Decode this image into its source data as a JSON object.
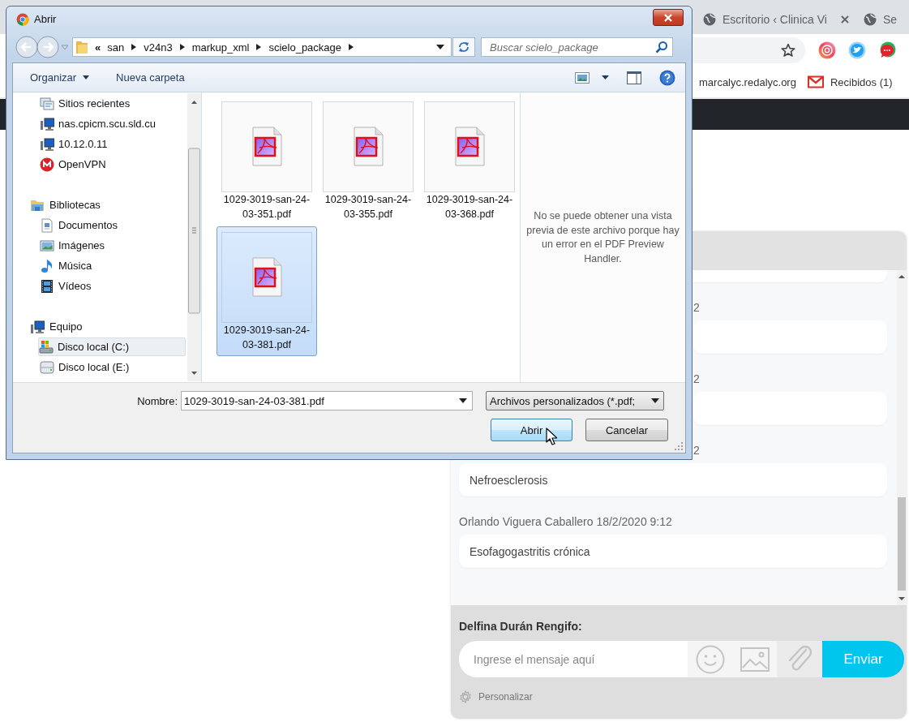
{
  "browser": {
    "tabs": [
      {
        "title": "Escritorio ‹ Clinica Vi",
        "selected": false,
        "closable": true
      },
      {
        "title": "Se",
        "selected": false,
        "closable": false
      }
    ],
    "bookmarks": [
      {
        "kind": "site",
        "label": "marcalyc.redalyc.org"
      },
      {
        "kind": "mail",
        "label": "Recibidos (1)"
      }
    ]
  },
  "chat": {
    "messages": [
      {
        "kind": "partial"
      },
      {
        "kind": "message",
        "header": "2",
        "header_covered": true,
        "bubble_covered": true
      },
      {
        "kind": "message",
        "header": "2",
        "header_covered": true,
        "bubble_covered": true
      },
      {
        "kind": "message",
        "header": "2",
        "header_covered": true,
        "bubble_covered": false,
        "text": "Nefroesclerosis"
      },
      {
        "kind": "message",
        "header": "Orlando Viguera Caballero 18/2/2020 9:12",
        "header_covered": false,
        "bubble_covered": false,
        "text": "Esofagogastritis crónica"
      }
    ],
    "sender": "Delfina Durán Rengifo:",
    "input": {
      "placeholder": "Ingrese el mensaje aquí"
    },
    "send_button": "Enviar",
    "settings_link": "Personalizar"
  },
  "dialog": {
    "title": "Abrir",
    "path": {
      "overflow_mark": "«",
      "segments": [
        "san",
        "v24n3",
        "markup_xml",
        "scielo_package"
      ]
    },
    "search": {
      "placeholder": "Buscar scielo_package"
    },
    "toolbar": [
      {
        "label": "Organizar",
        "menu": true
      },
      {
        "label": "Nueva carpeta",
        "menu": false
      }
    ],
    "sidebar": {
      "tree": [
        {
          "children": [
            {
              "label": "Sitios recientes",
              "kind": "recent",
              "selected": false
            },
            {
              "label": "nas.cpicm.scu.sld.cu",
              "kind": "network",
              "selected": false
            },
            {
              "label": "10.12.0.11",
              "kind": "network",
              "selected": false
            },
            {
              "label": "OpenVPN",
              "kind": "vpn",
              "selected": false
            }
          ]
        },
        {
          "label": "Bibliotecas",
          "kind": "library",
          "selected": false,
          "children": [
            {
              "label": "Documentos",
              "kind": "documents",
              "selected": false
            },
            {
              "label": "Imágenes",
              "kind": "pictures",
              "selected": false
            },
            {
              "label": "Música",
              "kind": "music",
              "selected": false
            },
            {
              "label": "Vídeos",
              "kind": "videos",
              "selected": false
            }
          ]
        },
        {
          "label": "Equipo",
          "kind": "computer",
          "selected": false,
          "children": [
            {
              "label": "Disco local (C:)",
              "kind": "system_drive",
              "selected": true
            },
            {
              "label": "Disco local (E:)",
              "kind": "drive",
              "selected": false
            }
          ]
        }
      ]
    },
    "files": [
      {
        "name": "1029-3019-san-24-03-351.pdf",
        "selected": false
      },
      {
        "name": "1029-3019-san-24-03-355.pdf",
        "selected": false
      },
      {
        "name": "1029-3019-san-24-03-368.pdf",
        "selected": false
      },
      {
        "name": "1029-3019-san-24-03-381.pdf",
        "selected": true
      }
    ],
    "preview_message": "No se puede obtener una vista previa de este archivo porque hay un error en el PDF Preview Handler.",
    "filename": {
      "label": "Nombre:",
      "value": "1029-3019-san-24-03-381.pdf"
    },
    "file_type": "Archivos personalizados (*.pdf;",
    "buttons": [
      {
        "label": "Abrir",
        "default": true
      },
      {
        "label": "Cancelar",
        "default": false
      }
    ]
  }
}
